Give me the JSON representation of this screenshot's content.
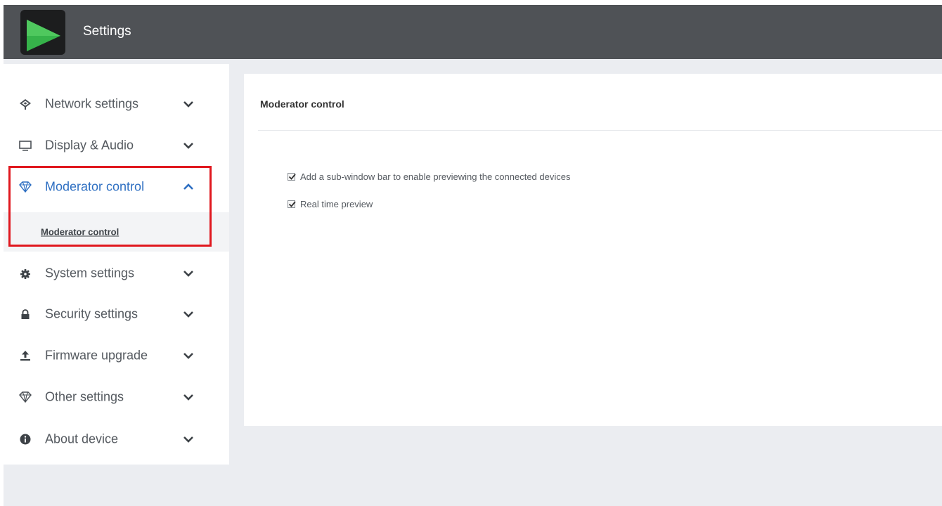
{
  "app": {
    "title": "Settings",
    "logo_icon": "play-triangle-icon",
    "header_color": "#4f5256",
    "logo_color": "#36b34a"
  },
  "sidebar": {
    "accent_color": "#2e6fc2",
    "items": [
      {
        "label": "Network settings",
        "icon": "wifi-icon",
        "expanded": false
      },
      {
        "label": "Display & Audio",
        "icon": "monitor-icon",
        "expanded": false
      },
      {
        "label": "Moderator control",
        "icon": "diamond-icon",
        "expanded": true,
        "active": true,
        "subitems": [
          {
            "label": "Moderator control"
          }
        ]
      },
      {
        "label": "System settings",
        "icon": "gear-icon",
        "expanded": false
      },
      {
        "label": "Security settings",
        "icon": "lock-icon",
        "expanded": false
      },
      {
        "label": "Firmware upgrade",
        "icon": "upload-icon",
        "expanded": false
      },
      {
        "label": "Other settings",
        "icon": "diamond-icon",
        "expanded": false
      },
      {
        "label": "About device",
        "icon": "info-icon",
        "expanded": false
      }
    ]
  },
  "highlight_color": "#e0171e",
  "panel": {
    "title": "Moderator control",
    "options": [
      {
        "label": "Add a sub-window bar to enable previewing the connected devices",
        "checked": true
      },
      {
        "label": "Real time preview",
        "checked": true
      }
    ]
  }
}
